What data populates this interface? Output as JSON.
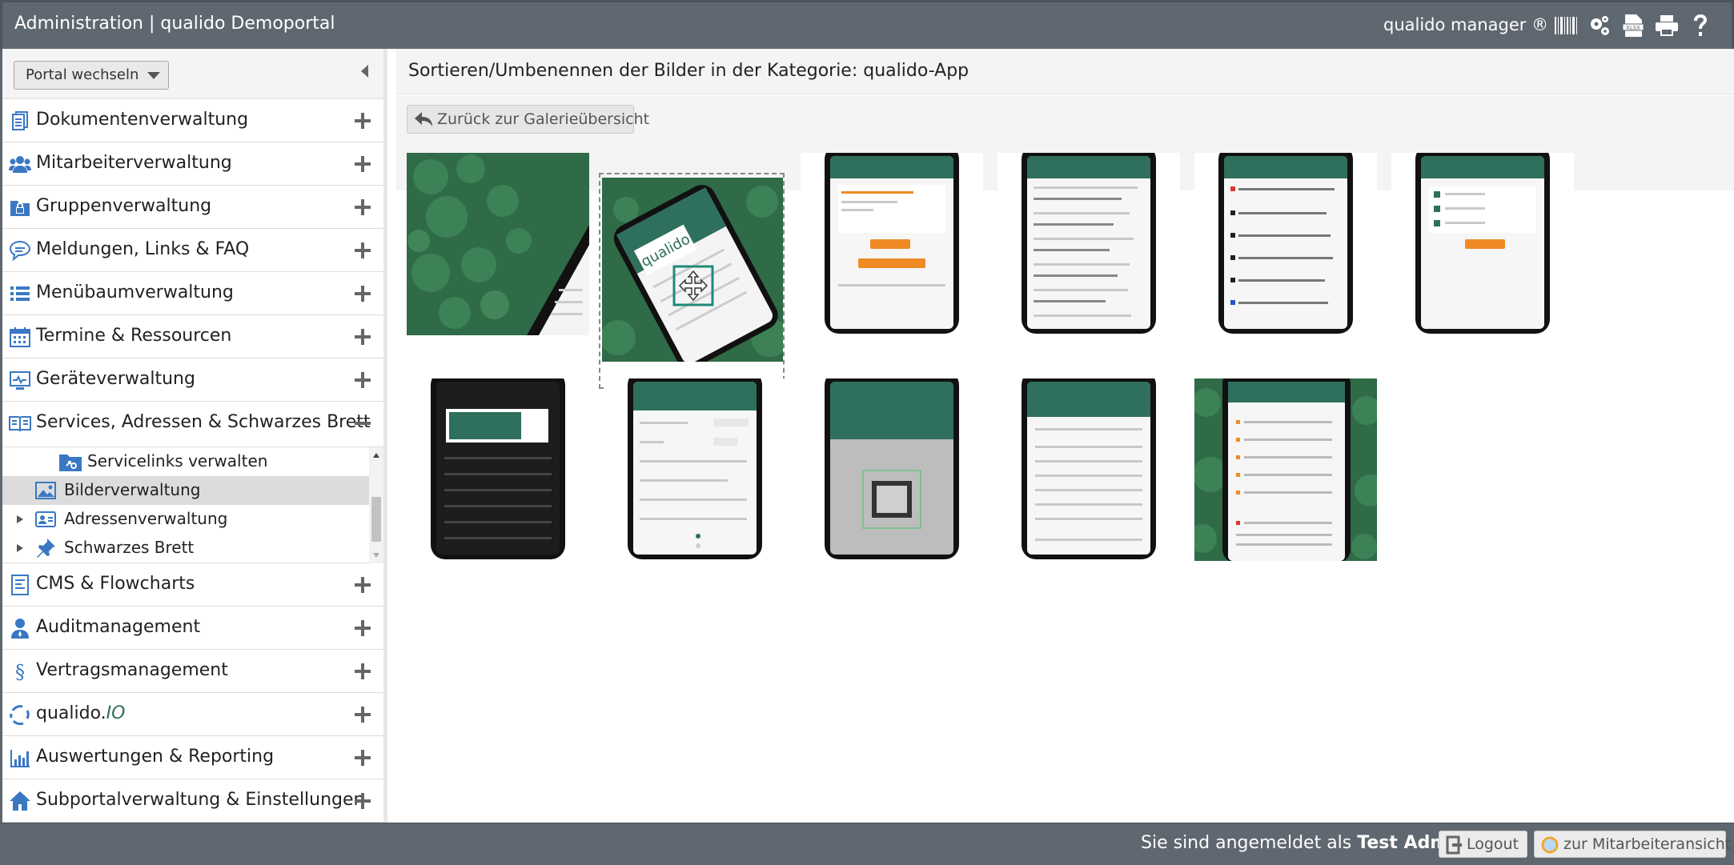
{
  "header": {
    "title": "Administration | qualido Demoportal",
    "brand": "qualido manager ®",
    "icons": [
      "barcode-icon",
      "gear-icon",
      "xlsx-icon",
      "print-icon",
      "help-icon"
    ]
  },
  "sidebar": {
    "portal_select": "Portal wechseln",
    "items_top": [
      {
        "label": "Dokumentenverwaltung",
        "icon": "document-icon"
      },
      {
        "label": "Mitarbeiterverwaltung",
        "icon": "users-icon"
      },
      {
        "label": "Gruppenverwaltung",
        "icon": "group-lock-icon"
      },
      {
        "label": "Meldungen, Links & FAQ",
        "icon": "chat-icon"
      },
      {
        "label": "Menübaumverwaltung",
        "icon": "list-icon"
      },
      {
        "label": "Termine & Ressourcen",
        "icon": "calendar-icon"
      },
      {
        "label": "Geräteverwaltung",
        "icon": "device-icon"
      },
      {
        "label": "Services, Adressen & Schwarzes Brett",
        "icon": "book-icon"
      }
    ],
    "submenu": [
      {
        "label": "Servicelinks verwalten"
      },
      {
        "label": "Bilderverwaltung"
      },
      {
        "label": "Adressenverwaltung"
      },
      {
        "label": "Schwarzes Brett"
      }
    ],
    "items_bottom": [
      {
        "label": "CMS & Flowcharts",
        "icon": "flowchart-icon"
      },
      {
        "label": "Auditmanagement",
        "icon": "auditor-icon"
      },
      {
        "label": "Vertragsmanagement",
        "icon": "paragraph-icon"
      },
      {
        "label": "qualido.",
        "label_suffix": "IO",
        "icon": "sync-icon"
      },
      {
        "label": "Auswertungen & Reporting",
        "icon": "bar-chart-icon"
      },
      {
        "label": "Subportalverwaltung & Einstellungen",
        "icon": "home-icon"
      }
    ]
  },
  "main": {
    "title": "Sortieren/Umbenennen der Bilder in der Kategorie: qualido-App",
    "back_button": "Zurück zur Galerieübersicht"
  },
  "footer": {
    "login_prefix": "Sie sind angemeldet als",
    "user": "Test Admin",
    "logout": "Logout",
    "employee_view": "zur Mitarbeiteransicht"
  },
  "colors": {
    "header": "#5f6770",
    "icon_blue": "#3a78c3",
    "accent_green": "#2f6f5d",
    "app_orange": "#f08a24"
  }
}
